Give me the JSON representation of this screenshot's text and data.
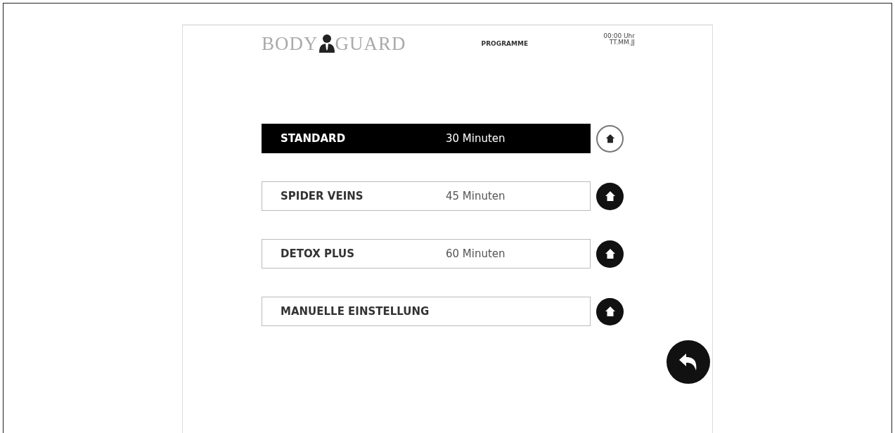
{
  "header": {
    "logo_left": "BODY",
    "logo_right": "GUARD",
    "title": "PROGRAMME",
    "time": "00:00 Uhr",
    "date": "TT.MM.JJ"
  },
  "programs": [
    {
      "name": "STANDARD",
      "duration": "30 Minuten",
      "selected": true
    },
    {
      "name": "SPIDER VEINS",
      "duration": "45 Minuten",
      "selected": false
    },
    {
      "name": "DETOX PLUS",
      "duration": "60 Minuten",
      "selected": false
    },
    {
      "name": "MANUELLE EINSTELLUNG",
      "selected": false
    }
  ]
}
